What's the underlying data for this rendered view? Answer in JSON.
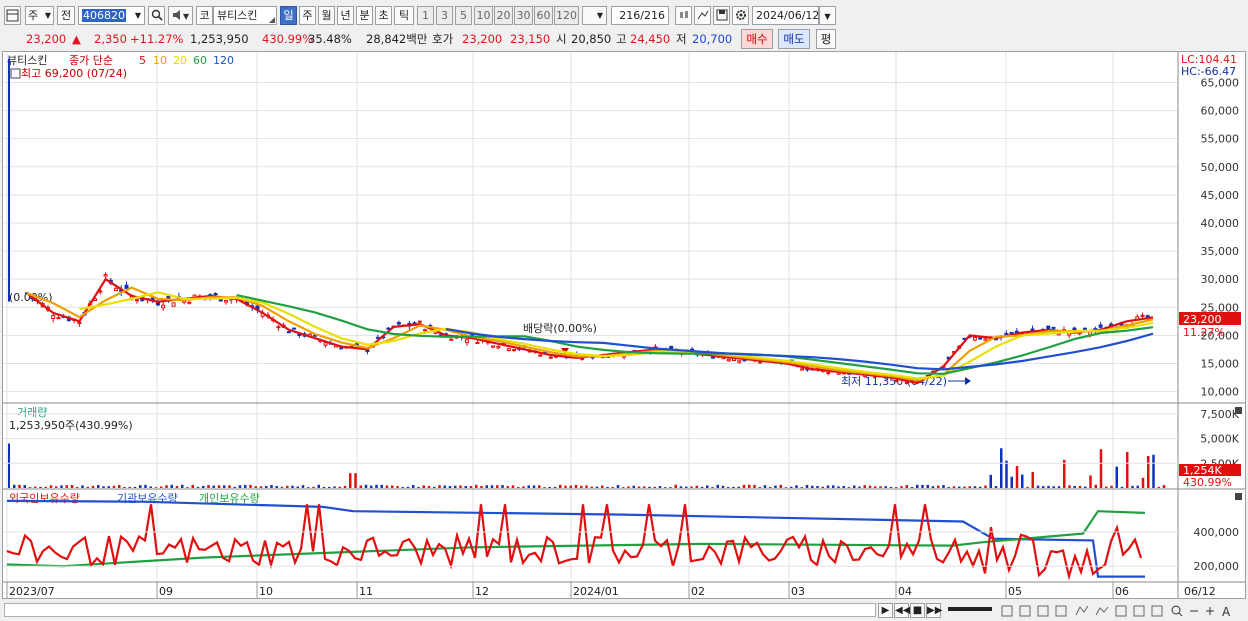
{
  "toolbar": {
    "market": "주",
    "prev": "전",
    "code": "406820",
    "stock_prefix": "코",
    "stock_name": "뷰티스킨",
    "periods": [
      "일",
      "주",
      "월",
      "년",
      "분",
      "초",
      "틱"
    ],
    "active_period": "일",
    "intervals": [
      "1",
      "3",
      "5",
      "10",
      "20",
      "30",
      "60",
      "120"
    ],
    "count": "216",
    "count_total": "/216",
    "date": "2024/06/12"
  },
  "quote": {
    "price": "23,200",
    "change_arrow": "▲",
    "change": "2,350",
    "change_pct": "+11.27%",
    "volume": "1,253,950",
    "vol_ratio": "430.99%",
    "turnover": "35.48%",
    "amount": "28,842백만",
    "hoga_label": "호가",
    "ask": "23,200",
    "bid": "23,150",
    "open_label": "시",
    "open": "20,850",
    "high_label": "고",
    "high": "24,450",
    "low_label": "저",
    "low": "20,700",
    "buy_label": "매수",
    "sell_label": "매도",
    "eval_label": "평"
  },
  "chart": {
    "legend_name": "뷰티스킨",
    "legend_type": "종가 단순",
    "ma_periods": [
      "5",
      "10",
      "20",
      "60",
      "120"
    ],
    "ma_colors": [
      "#e01010",
      "#f0a000",
      "#e8e000",
      "#20a040",
      "#2050d0"
    ],
    "high_annot": "최고 69,200 (07/24)",
    "low_annot": "최저 11,350 (04/22)",
    "dividend_annot": "배당락(0.00%)",
    "left_annot": "(0.00%)",
    "lc": "LC:104.41",
    "hc": "HC:-66.47",
    "price_axis": [
      "65,000",
      "60,000",
      "55,000",
      "50,000",
      "45,000",
      "40,000",
      "35,000",
      "30,000",
      "25,000",
      "20,000",
      "15,000",
      "10,000"
    ],
    "last_price_tag": "23,200",
    "last_pct_tag": "11.27%",
    "volume_title": "거래량",
    "volume_info": "1,253,950주(430.99%)",
    "volume_axis": [
      "7,500K",
      "5,000K",
      "2,500K"
    ],
    "volume_tag": "1,254K",
    "volume_pct_tag": "430.99%",
    "holdings_legend": [
      "외국인보유수량",
      "기관보유수량",
      "개인보유수량"
    ],
    "holdings_colors": [
      "#e01010",
      "#2050d0",
      "#20a040"
    ],
    "holdings_axis": [
      "400,000",
      "200,000"
    ],
    "date_axis": [
      "2023/07",
      "09",
      "10",
      "11",
      "12",
      "2024/01",
      "02",
      "03",
      "04",
      "05",
      "06"
    ],
    "date_tag": "06/12"
  },
  "chart_data": {
    "type": "candlestick",
    "title": "뷰티스킨",
    "price_range": [
      8500,
      69000
    ],
    "price_ticks": [
      65000,
      60000,
      55000,
      50000,
      45000,
      40000,
      35000,
      30000,
      25000,
      20000,
      15000,
      10000
    ],
    "months": [
      "2023/07",
      "09",
      "10",
      "11",
      "12",
      "2024/01",
      "02",
      "03",
      "04",
      "05",
      "06"
    ],
    "all_time_high": 69200,
    "all_time_low": 11350,
    "last_close": 23200,
    "weekly_close": [
      27500,
      24000,
      22500,
      30000,
      27000,
      26000,
      26500,
      27000,
      26500,
      24000,
      21000,
      19500,
      18000,
      17500,
      21500,
      22000,
      20000,
      19500,
      18500,
      17500,
      16500,
      16000,
      16500,
      17000,
      17500,
      17000,
      16500,
      16000,
      15500,
      15000,
      14000,
      13500,
      13000,
      12500,
      11500,
      14500,
      20000,
      19500,
      20500,
      21000,
      20500,
      21000,
      22500,
      23200
    ],
    "volume_ticks_k": [
      7500,
      5000,
      2500
    ],
    "last_volume_k": 1254,
    "holdings_ticks": [
      400000,
      200000
    ],
    "holdings_series": [
      {
        "name": "외국인보유수량",
        "color": "#e01010"
      },
      {
        "name": "기관보유수량",
        "color": "#2050d0"
      },
      {
        "name": "개인보유수량",
        "color": "#20a040"
      }
    ]
  },
  "bottom": {
    "nav": [
      "▶",
      "◀◀",
      "■",
      "▶▶"
    ]
  }
}
